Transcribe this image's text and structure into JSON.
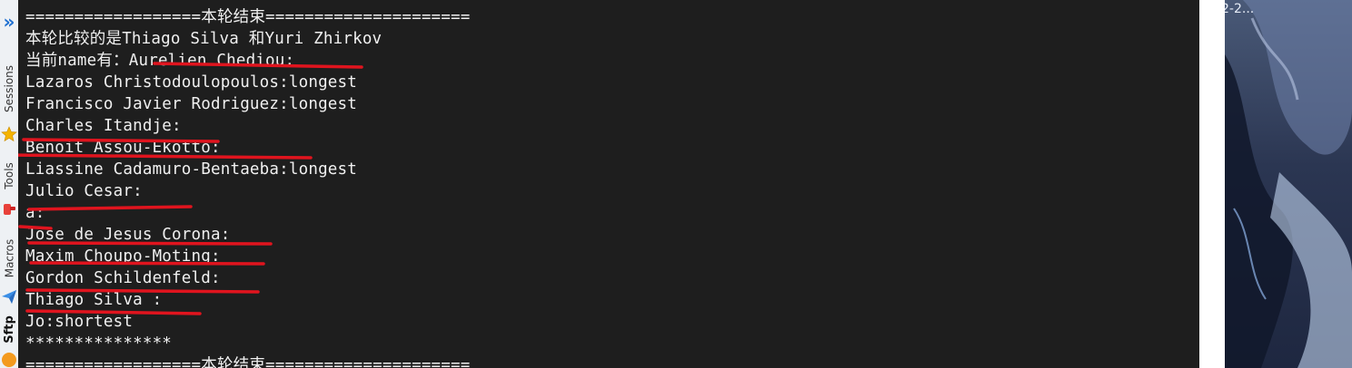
{
  "sidebar": {
    "expand_icon": "double-chevron-right-icon",
    "items": [
      {
        "label": "Sessions",
        "icon": "star-icon"
      },
      {
        "label": "Tools",
        "icon": "tools-icon"
      },
      {
        "label": "Macros",
        "icon": "paper-plane-icon"
      },
      {
        "label": "Sftp",
        "icon": "sftp-icon"
      }
    ]
  },
  "terminal": {
    "lines": [
      "==================本轮结束=====================",
      "本轮比较的是Thiago Silva 和Yuri Zhirkov",
      "当前name有：Aurelien Chediou:",
      "Lazaros Christodoulopoulos:longest",
      "Francisco Javier Rodriguez:longest",
      "Charles Itandje:",
      "Benoit Assou-Ekotto:",
      "Liassine Cadamuro-Bentaeba:longest",
      "Julio Cesar:",
      "a:",
      "Jose de Jesus Corona:",
      "Maxim Choupo-Moting:",
      "Gordon Schildenfeld:",
      "Thiago Silva :",
      "Jo:shortest",
      "***************",
      "==================本轮结束====================="
    ],
    "background": "#1e1e1e",
    "text_color": "#f0f0f0",
    "annotation_color": "#e0141e"
  },
  "right_panel": {
    "text": "2-2..."
  }
}
